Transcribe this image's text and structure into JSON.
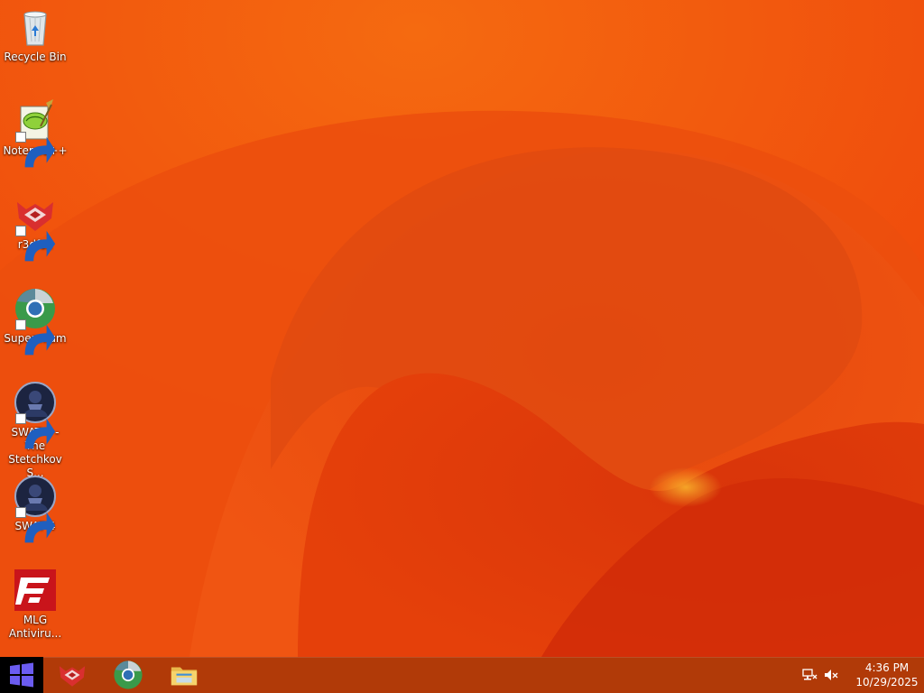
{
  "desktop": {
    "icons": [
      {
        "label": "Recycle Bin",
        "icon": "recycle-bin-icon",
        "shortcut": false
      },
      {
        "label": "Notepad++",
        "icon": "notepad-plus-plus-icon",
        "shortcut": true
      },
      {
        "label": "r3dfox",
        "icon": "r3dfox-icon",
        "shortcut": true
      },
      {
        "label": "Supermium",
        "icon": "supermium-icon",
        "shortcut": true
      },
      {
        "label": "SWAT 4 - The Stetchkov S...",
        "icon": "swat4-stetchkov-icon",
        "shortcut": true
      },
      {
        "label": "SWAT 4",
        "icon": "swat4-icon",
        "shortcut": true
      },
      {
        "label": "MLG Antiviru...",
        "icon": "mlg-antivirus-icon",
        "shortcut": false
      }
    ]
  },
  "taskbar": {
    "start_icon": "windows-logo-icon",
    "pinned_apps": [
      {
        "name": "r3dfox",
        "icon": "r3dfox-icon"
      },
      {
        "name": "Supermium",
        "icon": "supermium-icon"
      },
      {
        "name": "File Explorer",
        "icon": "file-explorer-icon"
      }
    ],
    "tray": {
      "network_icon": "network-icon",
      "volume_icon": "volume-muted-icon"
    },
    "clock": {
      "time": "4:36 PM",
      "date": "10/29/2025"
    }
  },
  "colors": {
    "wallpaper_base": "#ef4a0c",
    "wallpaper_highlight": "#f7a020",
    "wallpaper_shadow": "#d22a08",
    "taskbar": "#b13a08",
    "start_button": "#000000",
    "windows_logo": "#6b5cf0"
  }
}
